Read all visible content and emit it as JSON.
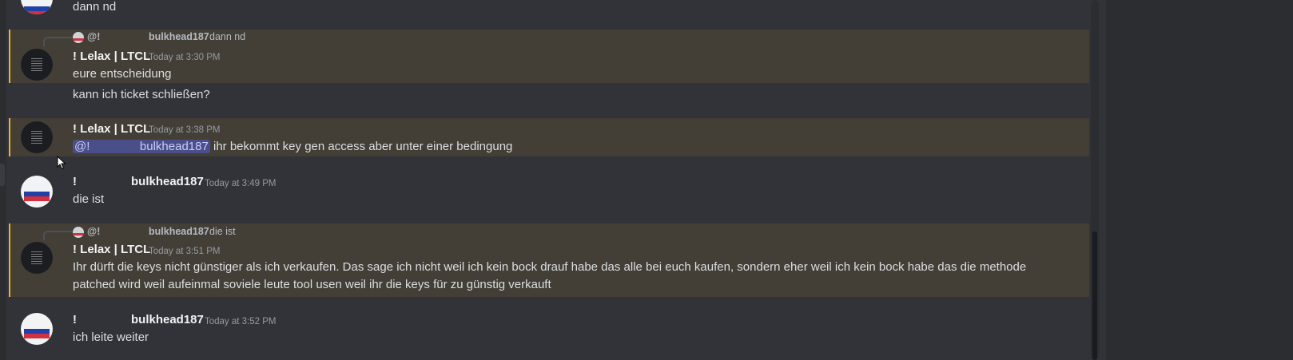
{
  "messages": {
    "m0": {
      "text": "dann nd"
    },
    "m1": {
      "reply": {
        "at": "@!",
        "user": "bulkhead187",
        "text": "dann nd"
      },
      "author": "! Lelax | LTCL",
      "time": "Today at 3:30 PM",
      "line1": "eure entscheidung",
      "line2": "kann ich ticket schließen?"
    },
    "m2": {
      "author": "! Lelax | LTCL",
      "time": "Today at 3:38 PM",
      "mention": "@!               bulkhead187",
      "text": " ihr bekommt key gen access aber unter einer bedingung"
    },
    "m3": {
      "prefix": "!",
      "author": "bulkhead187",
      "time": "Today at 3:49 PM",
      "text": "die ist"
    },
    "m4": {
      "reply": {
        "at": "@!",
        "user": "bulkhead187",
        "text": "die ist"
      },
      "author": "! Lelax | LTCL",
      "time": "Today at 3:51 PM",
      "line1": "Ihr dürft die keys nicht günstiger als ich verkaufen. Das sage ich nicht weil ich kein bock drauf habe das alle bei euch kaufen, sondern eher weil ich kein bock habe das die methode",
      "line2": "patched wird weil aufeinmal soviele leute tool usen weil ihr die keys für zu günstig verkauft"
    },
    "m5": {
      "prefix": "!",
      "author": "bulkhead187",
      "time": "Today at 3:52 PM",
      "text": "ich leite weiter"
    }
  },
  "colors": {
    "background": "#313338",
    "highlight": "#433f37",
    "highlight_border": "#f0b232",
    "mention": "#4a4f8a"
  },
  "icons": {
    "avatar_lelax": "dark-avatar-icon",
    "avatar_bulkhead": "flag-avatar-icon",
    "cursor": "mouse-cursor-icon"
  }
}
